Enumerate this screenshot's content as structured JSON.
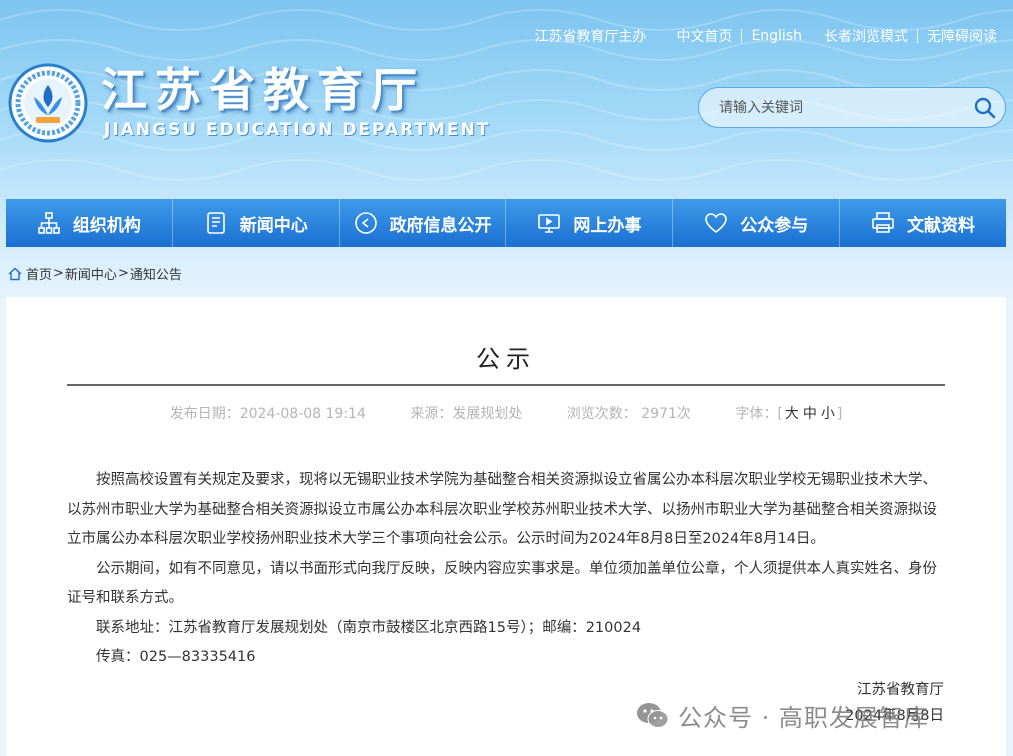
{
  "topbar": {
    "host": "江苏省教育厅主办",
    "links": [
      "中文首页",
      "English",
      "长者浏览模式",
      "无障碍阅读"
    ]
  },
  "logo": {
    "title": "江苏省教育厅",
    "subtitle": "JIANGSU EDUCATION DEPARTMENT"
  },
  "search": {
    "placeholder": "请输入关键词",
    "icon": "search-icon"
  },
  "nav": [
    {
      "label": "组织机构",
      "icon": "org-chart-icon"
    },
    {
      "label": "新闻中心",
      "icon": "document-icon"
    },
    {
      "label": "政府信息公开",
      "icon": "info-icon"
    },
    {
      "label": "网上办事",
      "icon": "monitor-icon"
    },
    {
      "label": "公众参与",
      "icon": "heart-icon"
    },
    {
      "label": "文献资料",
      "icon": "printer-icon"
    }
  ],
  "breadcrumb": {
    "icon": "home-icon",
    "items": [
      "首页",
      "新闻中心",
      "通知公告"
    ]
  },
  "article": {
    "title": "公示",
    "meta": {
      "date": "发布日期：2024-08-08 19:14",
      "source": "来源：发展规划处",
      "views": "浏览次数： 2971次",
      "font_label": "字体：",
      "font_sizes": [
        "大",
        "中",
        "小"
      ]
    },
    "paragraphs": [
      "按照高校设置有关规定及要求，现将以无锡职业技术学院为基础整合相关资源拟设立省属公办本科层次职业学校无锡职业技术大学、以苏州市职业大学为基础整合相关资源拟设立市属公办本科层次职业学校苏州职业技术大学、以扬州市职业大学为基础整合相关资源拟设立市属公办本科层次职业学校扬州职业技术大学三个事项向社会公示。公示时间为2024年8月8日至2024年8月14日。",
      "公示期间，如有不同意见，请以书面形式向我厅反映，反映内容应实事求是。单位须加盖单位公章，个人须提供本人真实姓名、身份证号和联系方式。",
      "联系地址：江苏省教育厅发展规划处（南京市鼓楼区北京西路15号）；邮编：210024",
      "传真：025—83335416"
    ],
    "signature": "江苏省教育厅",
    "sign_date": "2024年8月8日"
  },
  "watermark": "公众号 · 高职发展智库",
  "colors": {
    "nav_top": "#3e9be9",
    "nav_bottom": "#1b6fd2",
    "header_sky": "#7cc4f0"
  }
}
